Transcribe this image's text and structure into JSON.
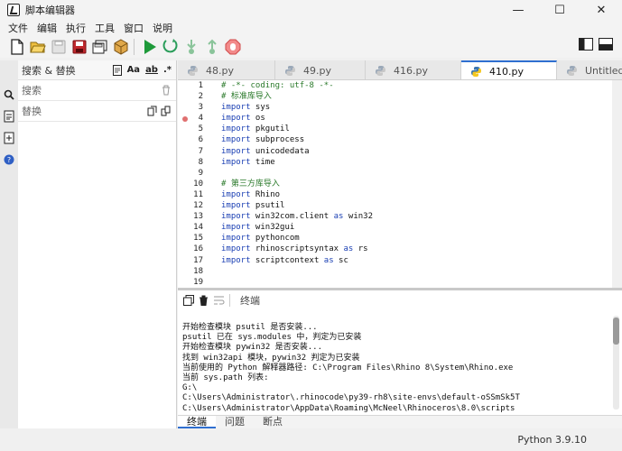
{
  "window": {
    "title": "脚本编辑器",
    "minimize": "—",
    "maximize": "☐",
    "close": "✕"
  },
  "menu": [
    "文件",
    "编辑",
    "执行",
    "工具",
    "窗口",
    "说明"
  ],
  "search_panel": {
    "title": "搜索 & 替换",
    "case_btn": "Aa",
    "word_btn": "ab",
    "regex_btn": ".*",
    "search_placeholder": "搜索",
    "replace_placeholder": "替换"
  },
  "tabs": [
    {
      "label": "48.py",
      "active": false
    },
    {
      "label": "49.py",
      "active": false
    },
    {
      "label": "416.py",
      "active": false
    },
    {
      "label": "410.py",
      "active": true
    },
    {
      "label": "Untitled.py",
      "active": false
    }
  ],
  "editor": {
    "line_numbers": [
      "1",
      "2",
      "3",
      "4",
      "5",
      "6",
      "7",
      "8",
      "9",
      "10",
      "11",
      "12",
      "13",
      "14",
      "15",
      "16",
      "17",
      "18",
      "19"
    ],
    "breakpoint_line": 4,
    "lines": [
      {
        "t": "c",
        "text": "# -*- coding: utf-8 -*-"
      },
      {
        "t": "c",
        "text": "# 标准库导入"
      },
      {
        "t": "i",
        "kw": "import",
        "rest": " sys"
      },
      {
        "t": "i",
        "kw": "import",
        "rest": " os"
      },
      {
        "t": "i",
        "kw": "import",
        "rest": " pkgutil"
      },
      {
        "t": "i",
        "kw": "import",
        "rest": " subprocess"
      },
      {
        "t": "i",
        "kw": "import",
        "rest": " unicodedata"
      },
      {
        "t": "i",
        "kw": "import",
        "rest": " time"
      },
      {
        "t": "e",
        "text": ""
      },
      {
        "t": "c",
        "text": "# 第三方库导入"
      },
      {
        "t": "i",
        "kw": "import",
        "rest": " Rhino"
      },
      {
        "t": "i",
        "kw": "import",
        "rest": " psutil"
      },
      {
        "t": "i",
        "kw": "import",
        "rest": " win32com.client ",
        "kw2": "as",
        "rest2": " win32"
      },
      {
        "t": "i",
        "kw": "import",
        "rest": " win32gui"
      },
      {
        "t": "i",
        "kw": "import",
        "rest": " pythoncom"
      },
      {
        "t": "i",
        "kw": "import",
        "rest": " rhinoscriptsyntax ",
        "kw2": "as",
        "rest2": " rs"
      },
      {
        "t": "i",
        "kw": "import",
        "rest": " scriptcontext ",
        "kw2": "as",
        "rest2": " sc"
      },
      {
        "t": "e",
        "text": ""
      },
      {
        "t": "e",
        "text": ""
      }
    ]
  },
  "console": {
    "title": "终端",
    "lines": [
      "开始检查模块 psutil 是否安装...",
      "psutil 已在 sys.modules 中，判定为已安装",
      "开始检查模块 pywin32 是否安装...",
      "找到 win32api 模块，pywin32 判定为已安装",
      "当前使用的 Python 解释器路径: C:\\Program Files\\Rhino 8\\System\\Rhino.exe",
      "当前 sys.path 列表:",
      "G:\\",
      "C:\\Users\\Administrator\\.rhinocode\\py39-rh8\\site-envs\\default-oSSmSk5T",
      "C:\\Users\\Administrator\\AppData\\Roaming\\McNeel\\Rhinoceros\\8.0\\scripts"
    ]
  },
  "bottom_tabs": [
    {
      "label": "终端",
      "active": true
    },
    {
      "label": "问题",
      "active": false
    },
    {
      "label": "断点",
      "active": false
    }
  ],
  "status": {
    "python_version": "Python 3.9.10"
  },
  "colors": {
    "accent": "#2f6fd0",
    "comment": "#2b7a2b",
    "keyword": "#1a3fb3",
    "run_green": "#1e9a3a",
    "save_red": "#c0282d",
    "stop_red": "#e05a5a"
  }
}
